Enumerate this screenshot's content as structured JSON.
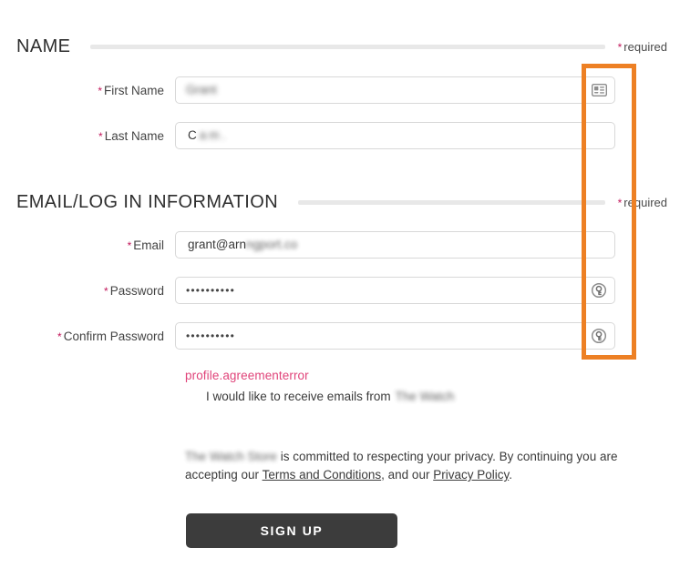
{
  "sections": {
    "name": {
      "title": "NAME",
      "required_label": "required",
      "required_star": "*"
    },
    "email_login": {
      "title": "EMAIL/LOG IN INFORMATION",
      "required_label": "required",
      "required_star": "*"
    }
  },
  "fields": {
    "first_name": {
      "label": "First Name",
      "star": "*",
      "value": "Grant",
      "placeholder": "",
      "icon": "contact-card-icon"
    },
    "last_name": {
      "label": "Last Name",
      "star": "*",
      "value": "C",
      "placeholder": "",
      "icon": ""
    },
    "email": {
      "label": "Email",
      "star": "*",
      "value_visible": "grant@arn",
      "value_redacted": "ngport.co",
      "placeholder": "",
      "icon": ""
    },
    "password": {
      "label": "Password",
      "star": "*",
      "masked_value": "••••••••••",
      "placeholder": "",
      "icon": "lastpass-key-icon"
    },
    "confirm_password": {
      "label": "Confirm Password",
      "star": "*",
      "masked_value": "••••••••••",
      "placeholder": "",
      "icon": "lastpass-key-icon"
    }
  },
  "messages": {
    "agreement_error": "profile.agreementerror",
    "marketing_optin_text": "I would like to receive emails from",
    "marketing_optin_brand": "The Watch",
    "privacy_brand": "The Watch Store",
    "privacy_text_1": "is committed to respecting your privacy. By continuing you are accepting our",
    "privacy_link_terms": "Terms and Conditions",
    "privacy_text_2": ", and our",
    "privacy_link_policy": "Privacy Policy",
    "privacy_text_3": "."
  },
  "actions": {
    "signup_label": "SIGN UP"
  },
  "annotation": {
    "type": "highlight-rectangle",
    "color": "#ed8024"
  },
  "colors": {
    "required_star": "#c2185b",
    "error_text": "#e0447a",
    "annotation": "#ed8024",
    "button_bg": "#3c3c3c",
    "divider": "#e8e8e8",
    "field_border": "#d8d8d8"
  }
}
